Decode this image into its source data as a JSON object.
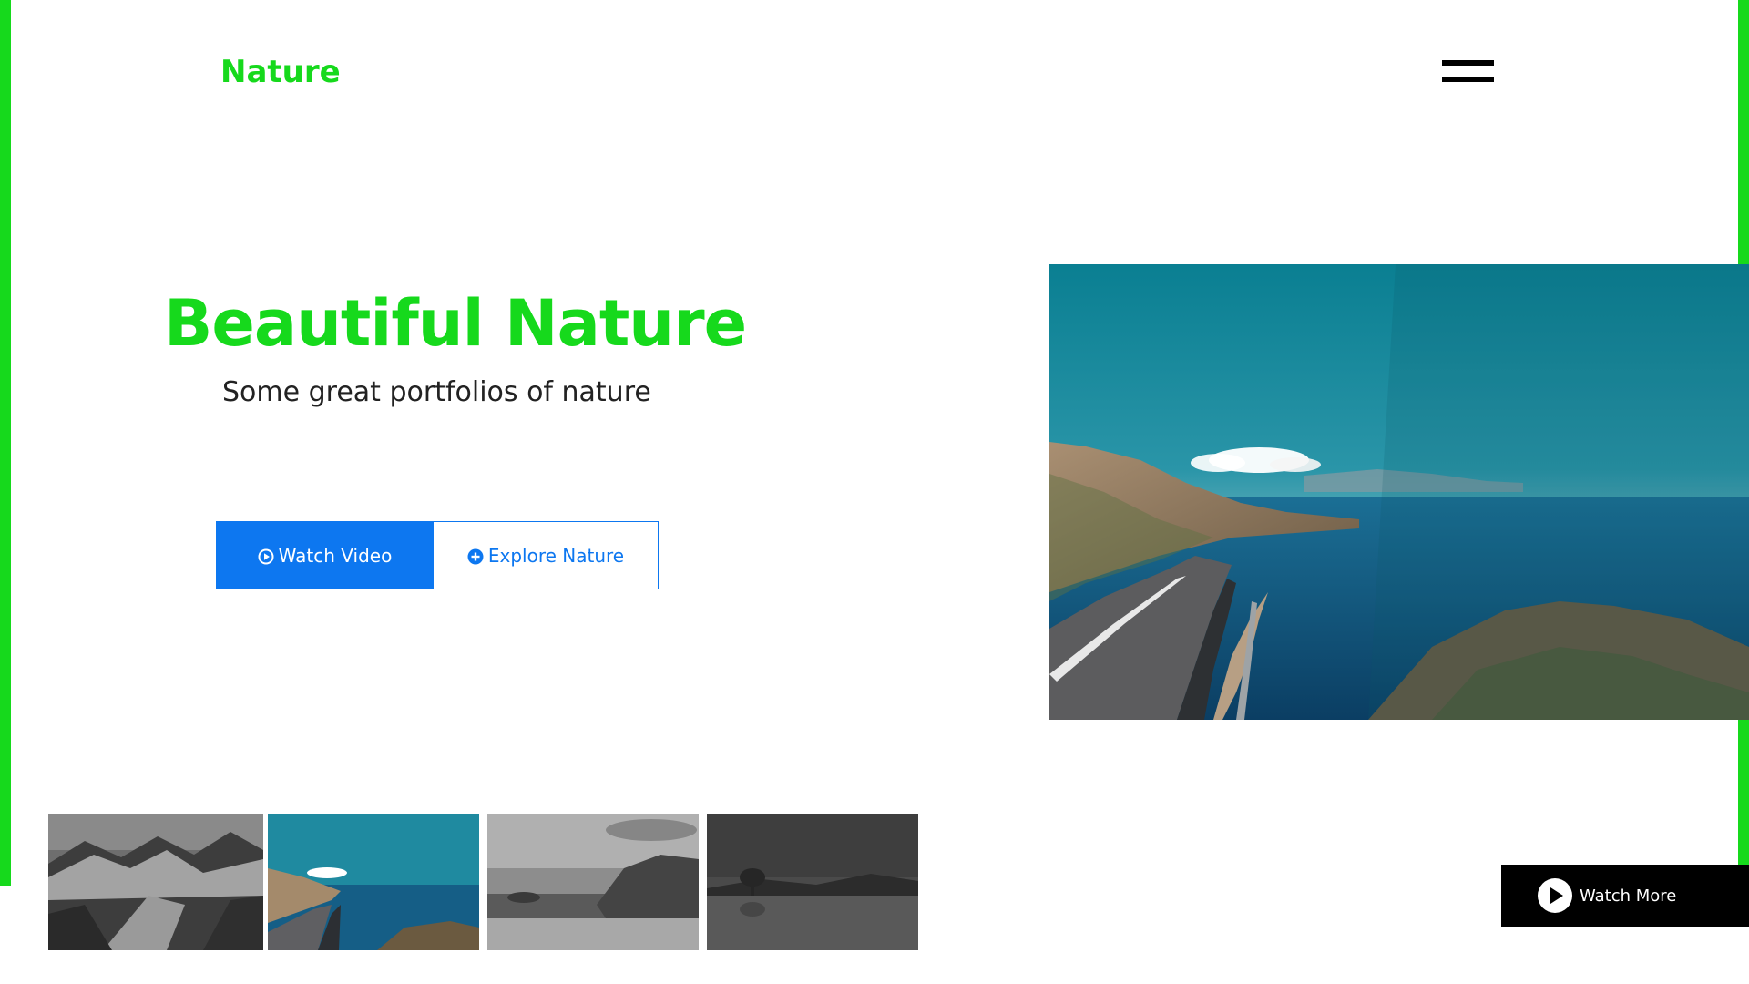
{
  "header": {
    "brand": "Nature",
    "menu_icon": "hamburger-menu-icon"
  },
  "hero": {
    "title": "Beautiful Nature",
    "subtitle": "Some great portfolios of nature",
    "watch_video_label": "Watch Video",
    "watch_video_icon": "play-circle-icon",
    "explore_label": "Explore Nature",
    "explore_icon": "plus-circle-icon",
    "image_subject": "coastal-road-sea-landscape"
  },
  "thumbnails": [
    {
      "subject": "snowy-mountains-grayscale",
      "grayscale": true
    },
    {
      "subject": "coastal-road-sea-color",
      "grayscale": false
    },
    {
      "subject": "beach-cliff-island-grayscale",
      "grayscale": true
    },
    {
      "subject": "lake-island-tree-grayscale",
      "grayscale": true
    }
  ],
  "watch_more": {
    "label": "Watch More",
    "icon": "play-icon"
  },
  "colors": {
    "accent_green": "#16d91c",
    "primary_blue": "#0d77f0",
    "text_dark": "#222222",
    "black": "#000000"
  }
}
